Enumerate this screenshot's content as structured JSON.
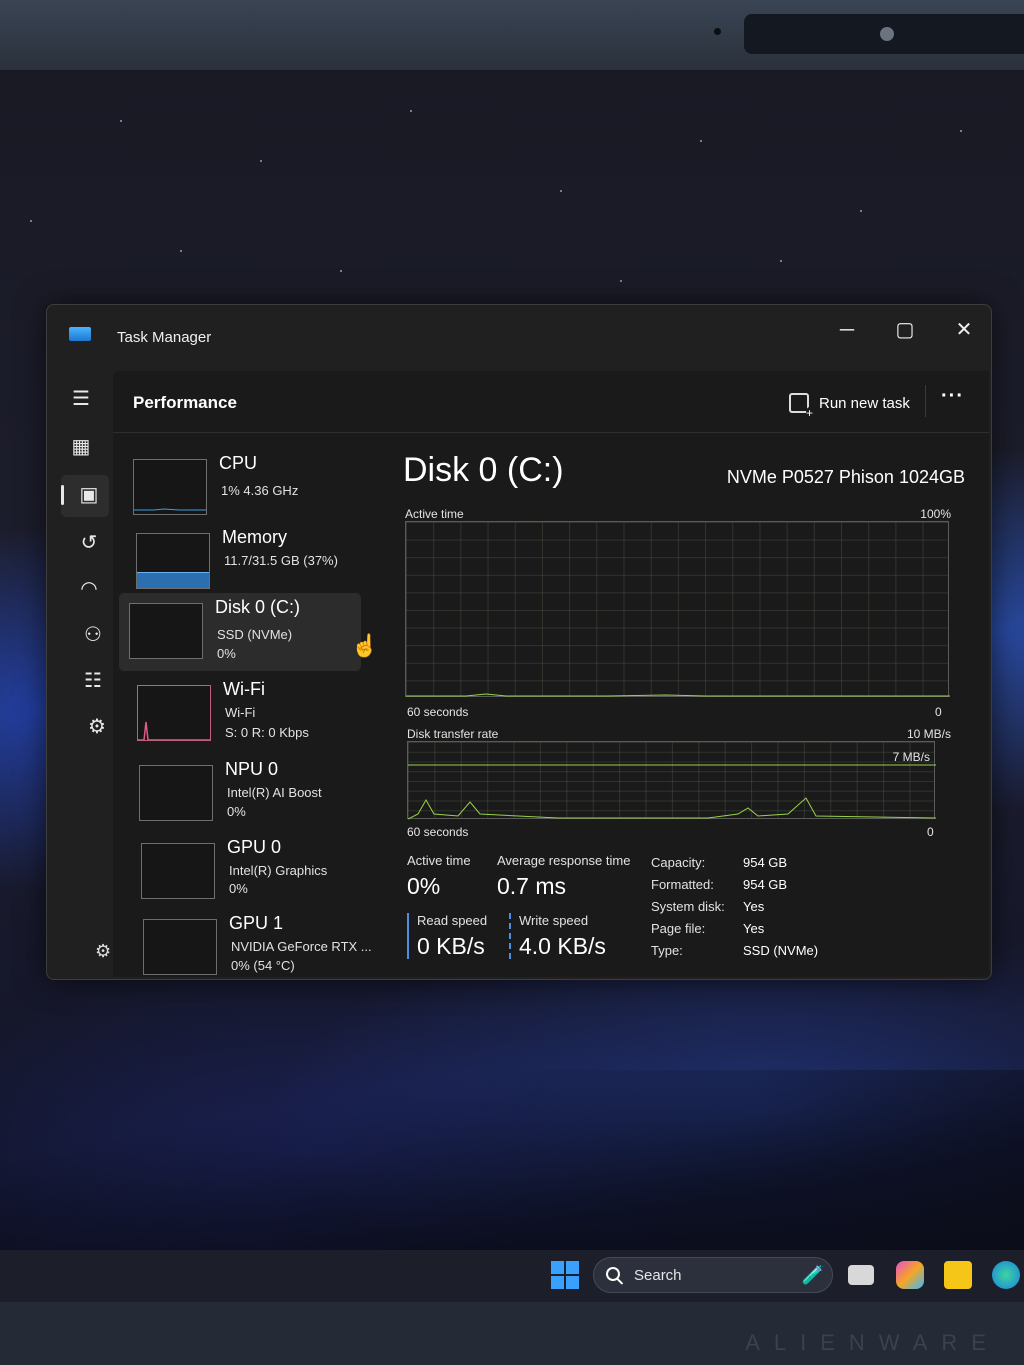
{
  "window": {
    "title": "Task Manager"
  },
  "header": {
    "title": "Performance",
    "run_new_task": "Run new task"
  },
  "devices": [
    {
      "name": "CPU",
      "line1": "1%  4.36 GHz",
      "line2": ""
    },
    {
      "name": "Memory",
      "line1": "11.7/31.5 GB (37%)",
      "line2": ""
    },
    {
      "name": "Disk 0 (C:)",
      "line1": "SSD (NVMe)",
      "line2": "0%"
    },
    {
      "name": "Wi-Fi",
      "line1": "Wi-Fi",
      "line2": "S: 0  R: 0 Kbps"
    },
    {
      "name": "NPU 0",
      "line1": "Intel(R) AI Boost",
      "line2": "0%"
    },
    {
      "name": "GPU 0",
      "line1": "Intel(R) Graphics",
      "line2": "0%"
    },
    {
      "name": "GPU 1",
      "line1": "NVIDIA GeForce RTX ...",
      "line2": "0%  (54 °C)"
    }
  ],
  "detail": {
    "title": "Disk 0 (C:)",
    "model": "NVMe P0527 Phison 1024GB",
    "active_time_graph": {
      "label": "Active time",
      "max": "100%",
      "time": "60 seconds",
      "min": "0"
    },
    "transfer_graph": {
      "label": "Disk transfer rate",
      "max": "10 MB/s",
      "marker": "7 MB/s",
      "time": "60 seconds",
      "min": "0"
    },
    "stats": {
      "active_time_label": "Active time",
      "active_time": "0%",
      "avg_response_label": "Average response time",
      "avg_response": "0.7 ms",
      "read_label": "Read speed",
      "read": "0 KB/s",
      "write_label": "Write speed",
      "write": "4.0 KB/s"
    },
    "properties": [
      {
        "key": "Capacity:",
        "value": "954 GB"
      },
      {
        "key": "Formatted:",
        "value": "954 GB"
      },
      {
        "key": "System disk:",
        "value": "Yes"
      },
      {
        "key": "Page file:",
        "value": "Yes"
      },
      {
        "key": "Type:",
        "value": "SSD (NVMe)"
      }
    ]
  },
  "taskbar": {
    "search_label": "Search"
  },
  "colors": {
    "accent": "#3aa0ff",
    "disk_graph": "#9bd24a",
    "wifi_graph": "#d8537a",
    "memory_graph": "#2b6fb0"
  }
}
